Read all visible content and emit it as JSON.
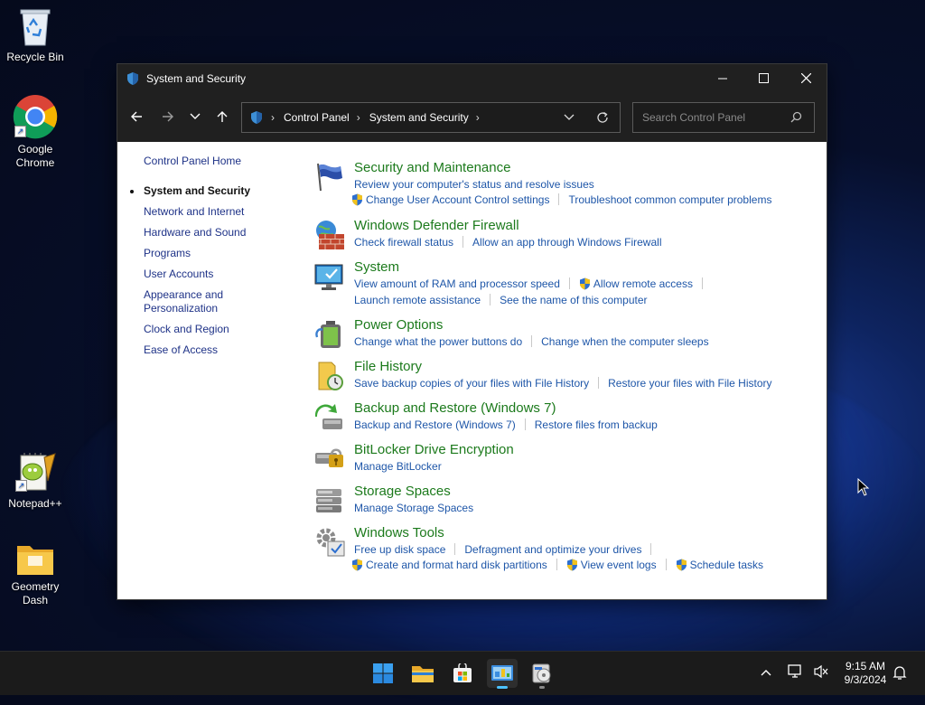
{
  "desktop": {
    "icons": [
      {
        "label": "Recycle Bin",
        "icon": "recycle-bin-icon"
      },
      {
        "label": "Google Chrome",
        "icon": "chrome-icon"
      },
      {
        "label": "Notepad++",
        "icon": "notepadpp-icon"
      },
      {
        "label": "Geometry Dash",
        "icon": "folder-icon"
      }
    ]
  },
  "window": {
    "title": "System and Security",
    "breadcrumb": [
      "Control Panel",
      "System and Security"
    ],
    "search_placeholder": "Search Control Panel"
  },
  "leftnav": {
    "items": [
      "Control Panel Home",
      "System and Security",
      "Network and Internet",
      "Hardware and Sound",
      "Programs",
      "User Accounts",
      "Appearance and Personalization",
      "Clock and Region",
      "Ease of Access"
    ],
    "current_index": 1
  },
  "categories": [
    {
      "title": "Security and Maintenance",
      "icon": "flag-icon",
      "rows": [
        [
          {
            "text": "Review your computer's status and resolve issues",
            "shield": false
          }
        ],
        [
          {
            "text": "Change User Account Control settings",
            "shield": true
          },
          {
            "text": "Troubleshoot common computer problems",
            "shield": false
          }
        ]
      ]
    },
    {
      "title": "Windows Defender Firewall",
      "icon": "firewall-icon",
      "rows": [
        [
          {
            "text": "Check firewall status",
            "shield": false
          },
          {
            "text": "Allow an app through Windows Firewall",
            "shield": false
          }
        ]
      ]
    },
    {
      "title": "System",
      "icon": "monitor-icon",
      "rows": [
        [
          {
            "text": "View amount of RAM and processor speed",
            "shield": false
          },
          {
            "text": "Allow remote access",
            "shield": true
          }
        ],
        [
          {
            "text": "Launch remote assistance",
            "shield": false
          },
          {
            "text": "See the name of this computer",
            "shield": false
          }
        ]
      ]
    },
    {
      "title": "Power Options",
      "icon": "battery-icon",
      "rows": [
        [
          {
            "text": "Change what the power buttons do",
            "shield": false
          },
          {
            "text": "Change when the computer sleeps",
            "shield": false
          }
        ]
      ]
    },
    {
      "title": "File History",
      "icon": "file-history-icon",
      "rows": [
        [
          {
            "text": "Save backup copies of your files with File History",
            "shield": false
          },
          {
            "text": "Restore your files with File History",
            "shield": false
          }
        ]
      ]
    },
    {
      "title": "Backup and Restore (Windows 7)",
      "icon": "backup-icon",
      "rows": [
        [
          {
            "text": "Backup and Restore (Windows 7)",
            "shield": false
          },
          {
            "text": "Restore files from backup",
            "shield": false
          }
        ]
      ]
    },
    {
      "title": "BitLocker Drive Encryption",
      "icon": "bitlocker-icon",
      "rows": [
        [
          {
            "text": "Manage BitLocker",
            "shield": false
          }
        ]
      ]
    },
    {
      "title": "Storage Spaces",
      "icon": "storage-icon",
      "rows": [
        [
          {
            "text": "Manage Storage Spaces",
            "shield": false
          }
        ]
      ]
    },
    {
      "title": "Windows Tools",
      "icon": "tools-icon",
      "rows": [
        [
          {
            "text": "Free up disk space",
            "shield": false
          },
          {
            "text": "Defragment and optimize your drives",
            "shield": false
          }
        ],
        [
          {
            "text": "Create and format hard disk partitions",
            "shield": true
          },
          {
            "text": "View event logs",
            "shield": true
          },
          {
            "text": "Schedule tasks",
            "shield": true
          }
        ]
      ]
    }
  ],
  "taskbar": {
    "apps": [
      "start-icon",
      "file-explorer-icon",
      "store-icon",
      "control-panel-icon",
      "installer-icon"
    ],
    "active_app": "control-panel-icon",
    "time": "9:15 AM",
    "date": "9/3/2024"
  },
  "colors": {
    "category_title": "#1c7a1c",
    "link": "#1e56a8",
    "nav_link": "#1e3287",
    "titlebar": "#202020"
  }
}
